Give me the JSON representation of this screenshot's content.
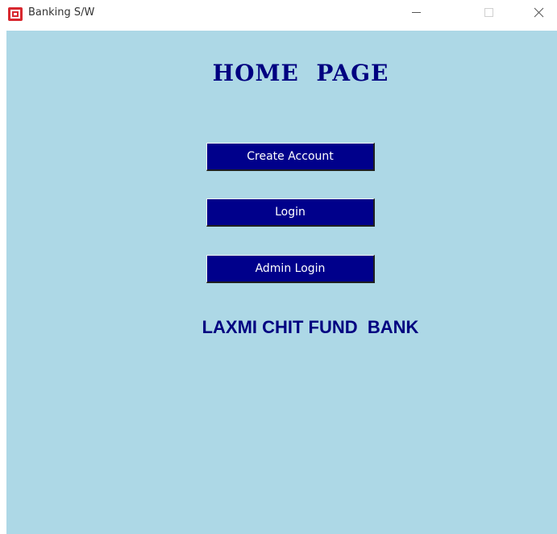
{
  "window": {
    "title": "Banking S/W",
    "controls": {
      "minimize_icon": "minimize-icon",
      "maximize_icon": "maximize-icon",
      "close_icon": "close-icon"
    }
  },
  "page": {
    "heading": "HOME  PAGE",
    "buttons": {
      "create_account": "Create Account",
      "login": "Login",
      "admin_login": "Admin Login"
    },
    "bank_name": "LAXMI CHIT FUND  BANK"
  },
  "colors": {
    "client_background": "#add8e6",
    "button_background": "#00008b",
    "button_text": "#ffffff",
    "heading_text": "#000080",
    "app_icon": "#d8282f"
  }
}
